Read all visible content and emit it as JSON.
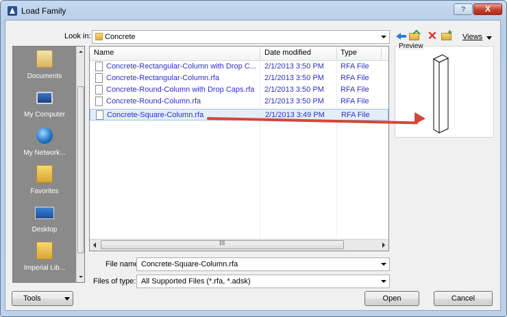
{
  "window": {
    "title": "Load Family",
    "help_glyph": "?",
    "close_glyph": "X"
  },
  "toolbar": {
    "look_in_label": "Look in:",
    "look_in_value": "Concrete",
    "views_label": "Views",
    "icons": [
      "back-icon",
      "up-folder-icon",
      "delete-icon",
      "new-folder-icon"
    ]
  },
  "places": [
    {
      "label": "Documents",
      "icon": "documents-icon"
    },
    {
      "label": "My Computer",
      "icon": "computer-icon"
    },
    {
      "label": "My Network...",
      "icon": "network-icon"
    },
    {
      "label": "Favorites",
      "icon": "favorites-icon"
    },
    {
      "label": "Desktop",
      "icon": "desktop-icon"
    },
    {
      "label": "Imperial Lib...",
      "icon": "folder-icon"
    }
  ],
  "filelist": {
    "columns": {
      "name": "Name",
      "date": "Date modified",
      "type": "Type"
    },
    "rows": [
      {
        "name": "Concrete-Rectangular-Column with Drop C...",
        "date": "2/1/2013 3:50 PM",
        "type": "RFA File"
      },
      {
        "name": "Concrete-Rectangular-Column.rfa",
        "date": "2/1/2013 3:50 PM",
        "type": "RFA File"
      },
      {
        "name": "Concrete-Round-Column with Drop Caps.rfa",
        "date": "2/1/2013 3:50 PM",
        "type": "RFA File"
      },
      {
        "name": "Concrete-Round-Column.rfa",
        "date": "2/1/2013 3:50 PM",
        "type": "RFA File"
      },
      {
        "name": "Concrete-Square-Column.rfa",
        "date": "2/1/2013 3:49 PM",
        "type": "RFA File"
      }
    ],
    "selected_index": 4,
    "scroll_grip": "III"
  },
  "preview": {
    "label": "Preview"
  },
  "form": {
    "file_name_label": "File name:",
    "file_name_value": "Concrete-Square-Column.rfa",
    "file_type_label": "Files of type:",
    "file_type_value": "All Supported Files  (*.rfa, *.adsk)"
  },
  "buttons": {
    "tools": "Tools",
    "open": "Open",
    "cancel": "Cancel"
  },
  "colors": {
    "accent_arrow": "#d6453a",
    "file_link": "#2d2ec8",
    "selection": "#e3eef9"
  }
}
